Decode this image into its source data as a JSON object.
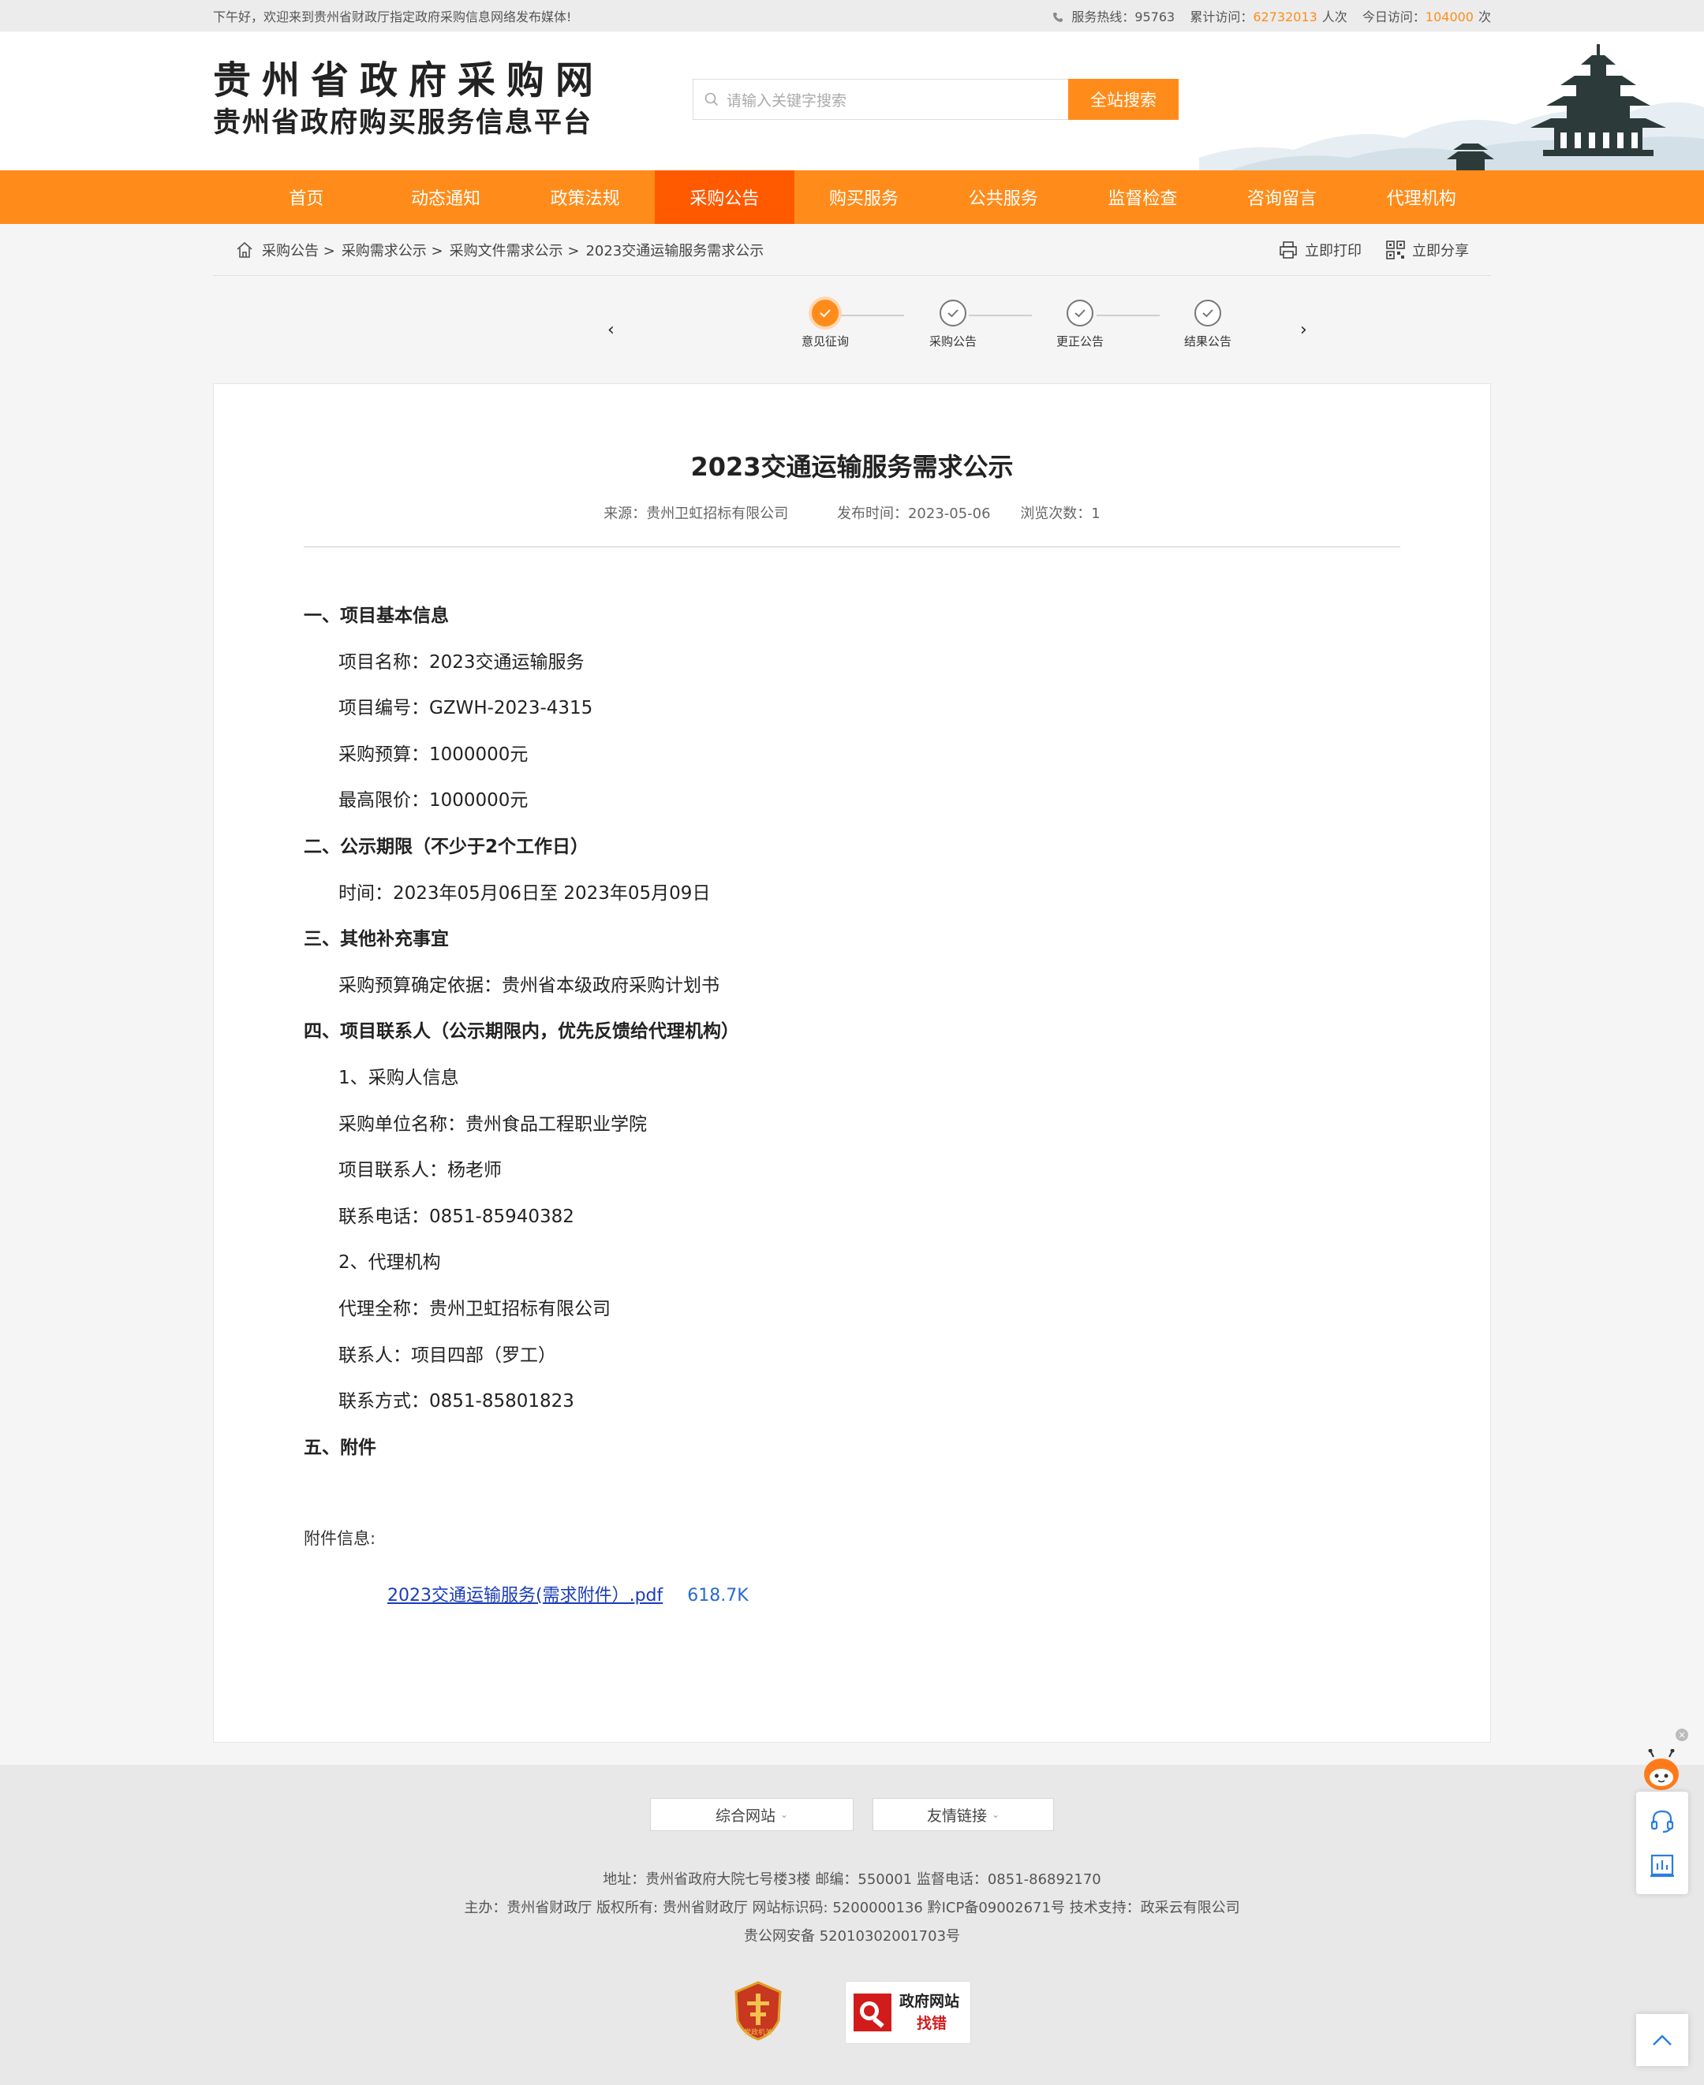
{
  "topbar": {
    "welcome": "下午好，欢迎来到贵州省财政厅指定政府采购信息网络发布媒体!",
    "hotline_label": "服务热线：",
    "hotline": "95763",
    "total_label": "累计访问：",
    "total": "62732013",
    "total_unit": "人次",
    "today_label": "今日访问：",
    "today": "104000",
    "today_unit": "次"
  },
  "header": {
    "logo_line1": "贵州省政府采购网",
    "logo_line2": "贵州省政府购买服务信息平台",
    "search_placeholder": "请输入关键字搜索",
    "search_button": "全站搜索"
  },
  "nav": [
    {
      "label": "首页"
    },
    {
      "label": "动态通知"
    },
    {
      "label": "政策法规"
    },
    {
      "label": "采购公告"
    },
    {
      "label": "购买服务"
    },
    {
      "label": "公共服务"
    },
    {
      "label": "监督检查"
    },
    {
      "label": "咨询留言"
    },
    {
      "label": "代理机构"
    }
  ],
  "breadcrumb": [
    "采购公告 >",
    "采购需求公示 >",
    "采购文件需求公示 >",
    "2023交通运输服务需求公示"
  ],
  "tools": {
    "print": "立即打印",
    "share": "立即分享"
  },
  "steps": [
    {
      "label": "意见征询",
      "active": true
    },
    {
      "label": "采购公告",
      "active": false
    },
    {
      "label": "更正公告",
      "active": false
    },
    {
      "label": "结果公告",
      "active": false
    }
  ],
  "article": {
    "title": "2023交通运输服务需求公示",
    "source": "来源：贵州卫虹招标有限公司",
    "date": "发布时间：2023-05-06",
    "views": "浏览次数：1",
    "lines": [
      {
        "type": "h",
        "text": "一、项目基本信息"
      },
      {
        "type": "p",
        "text": "项目名称：2023交通运输服务"
      },
      {
        "type": "p",
        "text": "项目编号：GZWH-2023-4315"
      },
      {
        "type": "p",
        "text": "采购预算：1000000元"
      },
      {
        "type": "p",
        "text": "最高限价：1000000元"
      },
      {
        "type": "h",
        "text": "二、公示期限（不少于2个工作日）"
      },
      {
        "type": "p",
        "text": "时间：2023年05月06日至 2023年05月09日"
      },
      {
        "type": "h",
        "text": "三、其他补充事宜"
      },
      {
        "type": "p",
        "text": "采购预算确定依据：贵州省本级政府采购计划书"
      },
      {
        "type": "h",
        "text": "四、项目联系人（公示期限内，优先反馈给代理机构）"
      },
      {
        "type": "p",
        "text": "1、采购人信息"
      },
      {
        "type": "p",
        "text": "采购单位名称：贵州食品工程职业学院"
      },
      {
        "type": "p",
        "text": "项目联系人：杨老师"
      },
      {
        "type": "p",
        "text": "联系电话：0851-85940382"
      },
      {
        "type": "p",
        "text": "2、代理机构"
      },
      {
        "type": "p",
        "text": "代理全称：贵州卫虹招标有限公司"
      },
      {
        "type": "p",
        "text": "联系人：项目四部（罗工）"
      },
      {
        "type": "p",
        "text": "联系方式：0851-85801823"
      },
      {
        "type": "h",
        "text": "五、附件"
      }
    ],
    "attach_label": "附件信息:",
    "attach_name": "2023交通运输服务(需求附件）.pdf",
    "attach_size": "618.7K"
  },
  "footer": {
    "link1": "综合网站",
    "link2": "友情链接",
    "line1": "地址：贵州省政府大院七号楼3楼 邮编：550001 监督电话：0851-86892170",
    "line2": "主办：贵州省财政厅 版权所有: 贵州省财政厅 网站标识码: 5200000136 黔ICP备09002671号 技术支持：政采云有限公司",
    "line3": "贵公网安备 52010302001703号",
    "badge_text1": "党政机关",
    "badge2_line1": "政府网站",
    "badge2_line2": "找错"
  },
  "colors": {
    "accent": "#ff8c1a",
    "nav_active": "#ff5a00",
    "link": "#1a3db8"
  }
}
